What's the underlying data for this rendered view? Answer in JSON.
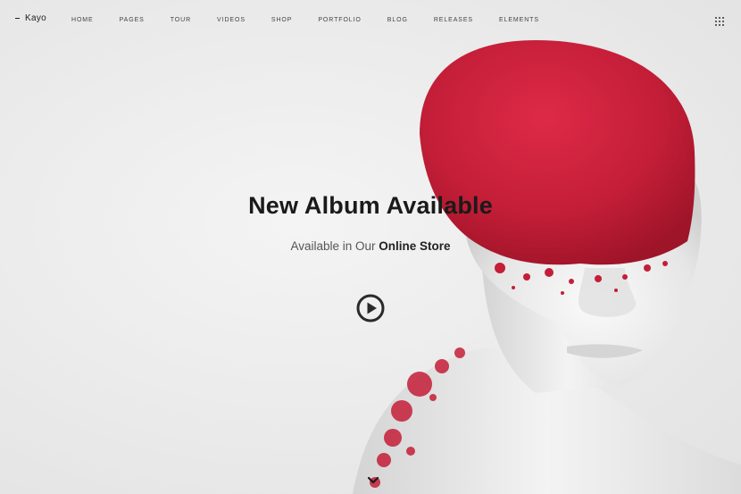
{
  "brand": {
    "name": "Kayo"
  },
  "nav": {
    "items": [
      {
        "label": "HOME"
      },
      {
        "label": "PAGES"
      },
      {
        "label": "TOUR"
      },
      {
        "label": "VIDEOS"
      },
      {
        "label": "SHOP"
      },
      {
        "label": "PORTFOLIO"
      },
      {
        "label": "BLOG"
      },
      {
        "label": "RELEASES"
      },
      {
        "label": "ELEMENTS"
      }
    ],
    "menu_icon": "grid-menu-icon"
  },
  "hero": {
    "title": "New Album Available",
    "subtitle_prefix": "Available in Our ",
    "subtitle_strong": "Online Store",
    "play_icon": "play-icon",
    "scroll_icon": "chevron-down-icon"
  },
  "colors": {
    "accent_red": "#c8203a",
    "background": "#ececec",
    "text_dark": "#1a1a1a"
  }
}
